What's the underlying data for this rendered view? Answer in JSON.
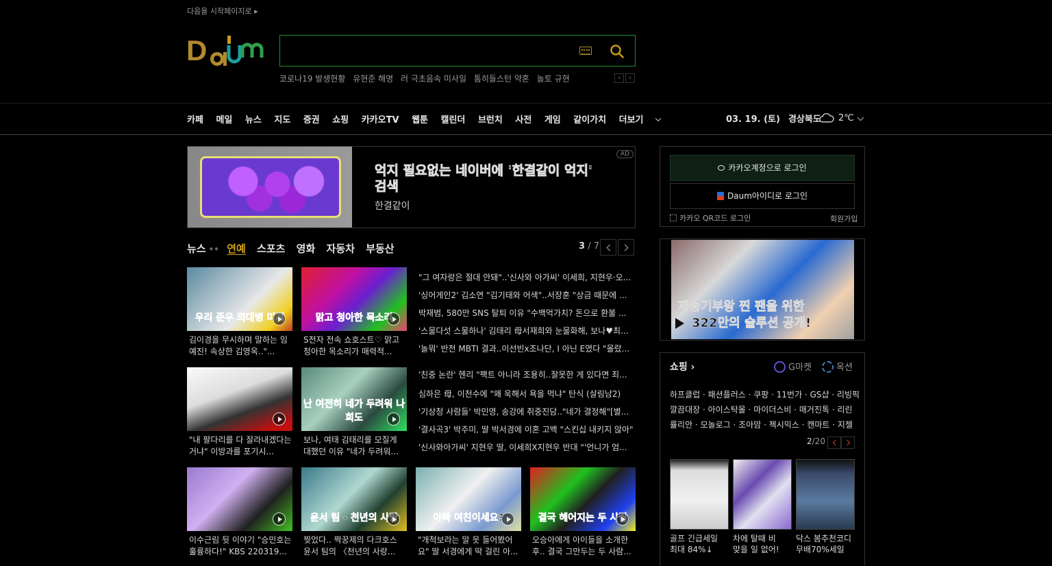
{
  "top": {
    "start_page": "다음을 시작페이지로",
    "search_placeholder": "",
    "trends": [
      "코로나19 발생현황",
      "유현준 해명",
      "러 극초음속 미사일",
      "톰히들스턴 약혼",
      "놀토 규현"
    ]
  },
  "logo": {
    "text": "Daum"
  },
  "nav": {
    "items": [
      "카페",
      "메일",
      "뉴스",
      "지도",
      "증권",
      "쇼핑",
      "카카오TV",
      "웹툰",
      "캘린더",
      "브런치",
      "사전",
      "게임",
      "같이가치"
    ],
    "more": "더보기"
  },
  "weather": {
    "date": "03. 19. (토)",
    "location": "경상북도",
    "temp": "2℃",
    "icon": "cloud-icon"
  },
  "ad": {
    "title": "억지 필요없는 네이버에 '한결같이 억지' 검색",
    "brand": "한결같이",
    "badge": "AD"
  },
  "news": {
    "tabs": [
      "뉴스",
      "연예",
      "스포츠",
      "영화",
      "자동차",
      "부동산"
    ],
    "active_tab": "연예",
    "page_current": "3",
    "page_total": "/ 7",
    "thumbs": [
      {
        "caption": "김이경을 무시하며 말하는 임예진! 속상한 김영옥..\"...",
        "overlay": "우리 준우 의대병 미져"
      },
      {
        "caption": "S전자 전속 쇼호스트♡ 맑고 청아한 목소리가 매력적...",
        "overlay": "맑고 청아한 목소리"
      },
      {
        "caption": "\"내 팔다리를 다 잘라내겠다는 거냐\" 이방과를 포기시...",
        "overlay": ""
      },
      {
        "caption": "보나, 여태 김태리를 모질게 대했던 이유 \"네가 두려워...",
        "overlay": "난 여전히 네가 두려워 나희도"
      },
      {
        "caption": "이수근림 뒷 이야기 \"승민호는 훌륭하다!\" KBS 220319...",
        "overlay": ""
      },
      {
        "caption": "찢었다.. 짝꿍제의 다크호스 윤서 팀의 〈천년의 사랑...",
        "overlay": "윤서 팀 - 천년의 사랑"
      },
      {
        "caption": "\"개척보라는 말 못 들어봤어요\" 딸 서경에게 딱 걸린 아...",
        "overlay": "아빠 여친이세요?"
      },
      {
        "caption": "오승아에게 아이들을 소개한 후.. 결국 그만두는 두 사람...",
        "overlay": "결국 헤어지는 두 사람"
      }
    ],
    "headlines": [
      "\"그 여자랑은 절대 안돼\"..'신사와 아가씨' 이세희, 지현우·오...",
      "'싱어게인2' 김소연 \"김기태와 어색\"..서장훈 \"상금 때문에 ...",
      "박재범, 580만 SNS 탈퇴 이유 \"수백억가치? 돈으로 환불 ...",
      "'스물다섯 스물하나' 김태리 母서재희와 눈물화해, 보나♥최...",
      "'놀뭐' 반전 MBTI 결과..이선빈x조나단, I 아닌 E였다 \"몰랐...",
      "'친중 논란' 헨리 \"팩트 아니라 조용히..잘못한 게 있다면 죄...",
      "심하은 母, 이천수에 \"왜 욱해서 욕을 먹냐\" 탄식 (살림남2)",
      "'기상청 사람들' 박민영, 송강에 취중진담..\"네가 결정해\"[별...",
      "'결사곡3' 박주미, 딸 박서경에 이혼 고백 \"스킨십 내키지 않아\"",
      "'신사와아가씨' 지현우 딸, 이세희X지현우 반대 \"'언니가 엄..."
    ]
  },
  "login": {
    "kakao": "카카오계정으로 로그인",
    "daum": "Daum아이디로 로그인",
    "qr": "카카오 QR코드 로그인",
    "signup": "회원가입"
  },
  "promo": {
    "line1": "재능기부왕 찐 팬을 위한",
    "line2": "322만의 슬루션 공개!"
  },
  "shopping": {
    "title": "쇼핑",
    "gmarket": "G마켓",
    "auction": "옥션",
    "links1": "하프클럽 · 패션플러스 · 쿠팡 · 11번가 · GS샵 · 리빙픽",
    "links2": "깔끔대장 · 아이스탁몰 · 마이더스비 · 매거진톡 · 리린",
    "links3": "률리안 · 모놀로그 · 조아맘 · 젝시믹스 · 캔마트 · 지젤",
    "page_current": "2",
    "page_total": "/20",
    "products": [
      {
        "line1": "골프 긴급세일",
        "line2": "최대 84%↓"
      },
      {
        "line1": "차에 탈때 비",
        "line2": "맞을 일 없어!"
      },
      {
        "line1": "닥스 봄추천코디",
        "line2": "무배70%세일"
      }
    ]
  }
}
